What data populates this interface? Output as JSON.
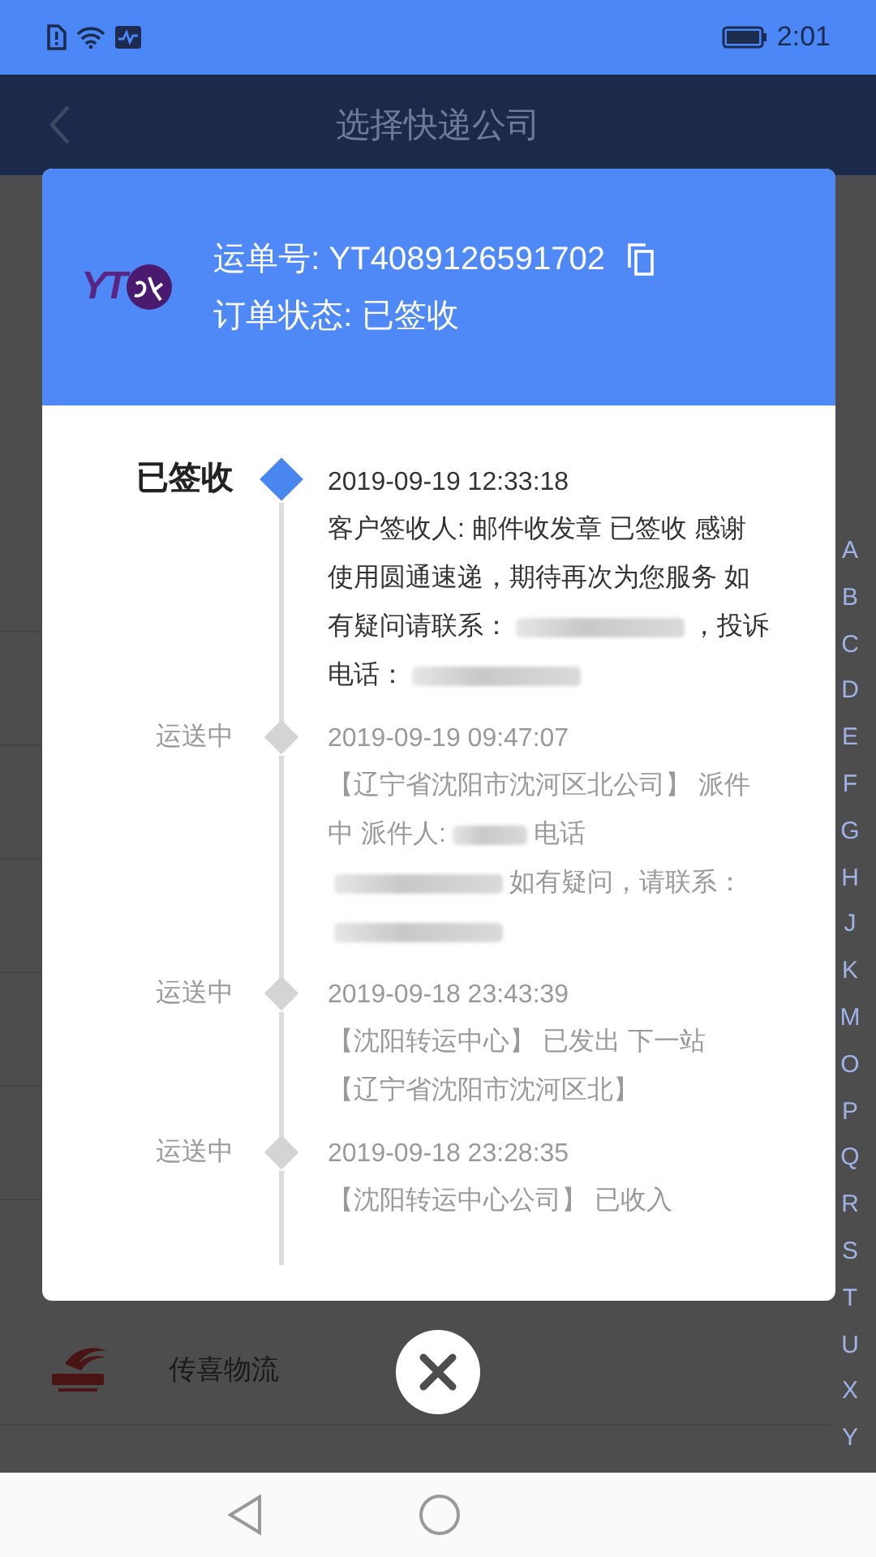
{
  "status_bar": {
    "time": "2:01"
  },
  "nav_bar": {
    "title": "选择快递公司"
  },
  "background_list": {
    "rows": [
      {
        "name": "传喜物流"
      }
    ]
  },
  "index_letters": [
    "A",
    "B",
    "C",
    "D",
    "E",
    "F",
    "G",
    "H",
    "J",
    "K",
    "M",
    "O",
    "P",
    "Q",
    "R",
    "S",
    "T",
    "U",
    "X",
    "Y"
  ],
  "dialog": {
    "logo_text": "YT",
    "waybill": "运单号: YT4089126591702",
    "order_status": "订单状态: 已签收",
    "events": [
      {
        "status": "已签收",
        "current": true,
        "time": "2019-09-19 12:33:18",
        "lines": [
          [
            {
              "kind": "text",
              "text": "客户签收人: 邮件收发章 已签收  感谢"
            }
          ],
          [
            {
              "kind": "text",
              "text": "使用圆通速递，期待再次为您服务 如"
            }
          ],
          [
            {
              "kind": "text",
              "text": "有疑问请联系："
            },
            {
              "kind": "redacted-phone"
            },
            {
              "kind": "text",
              "text": "，投诉"
            }
          ],
          [
            {
              "kind": "text",
              "text": "电话："
            },
            {
              "kind": "redacted-phone"
            }
          ]
        ]
      },
      {
        "status": "运送中",
        "current": false,
        "time": "2019-09-19 09:47:07",
        "lines": [
          [
            {
              "kind": "text",
              "text": "【辽宁省沈阳市沈河区北公司】 派件"
            }
          ],
          [
            {
              "kind": "text",
              "text": "中  派件人:"
            },
            {
              "kind": "redacted-name"
            },
            {
              "kind": "text",
              "text": "电话"
            }
          ],
          [
            {
              "kind": "redacted-phone"
            },
            {
              "kind": "text",
              "text": "如有疑问，请联系："
            }
          ],
          [
            {
              "kind": "redacted-phone"
            }
          ]
        ]
      },
      {
        "status": "运送中",
        "current": false,
        "time": "2019-09-18 23:43:39",
        "lines": [
          [
            {
              "kind": "text",
              "text": "【沈阳转运中心】 已发出 下一站"
            }
          ],
          [
            {
              "kind": "text",
              "text": "【辽宁省沈阳市沈河区北】"
            }
          ]
        ]
      },
      {
        "status": "运送中",
        "current": false,
        "time": "2019-09-18 23:28:35",
        "lines": [
          [
            {
              "kind": "text",
              "text": "【沈阳转运中心公司】 已收入"
            }
          ]
        ]
      }
    ]
  }
}
